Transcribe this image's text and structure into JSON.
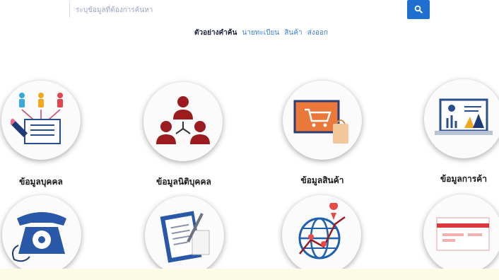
{
  "search": {
    "placeholder": "ระบุข้อมูลที่ต้องการค้นหา",
    "icon": "search-icon",
    "button_color": "#1e6fd0"
  },
  "examples": {
    "label": "ตัวอย่างคำค้น",
    "items": [
      "นายทะเบียน",
      "สินค้า",
      "ส่งออก"
    ]
  },
  "categories": [
    {
      "label": "ข้อมูลบุคคล",
      "icon": "person-form-icon"
    },
    {
      "label": "ข้อมูลนิติบุคคล",
      "icon": "organization-icon"
    },
    {
      "label": "ข้อมูลสินค้า",
      "icon": "shopping-cart-icon"
    },
    {
      "label": "ข้อมูลการค้า",
      "icon": "trade-dashboard-icon"
    },
    {
      "label": "",
      "icon": "telephone-icon"
    },
    {
      "label": "",
      "icon": "clipboard-document-icon"
    },
    {
      "label": "",
      "icon": "globe-map-pin-icon"
    },
    {
      "label": "",
      "icon": "card-icon"
    }
  ]
}
